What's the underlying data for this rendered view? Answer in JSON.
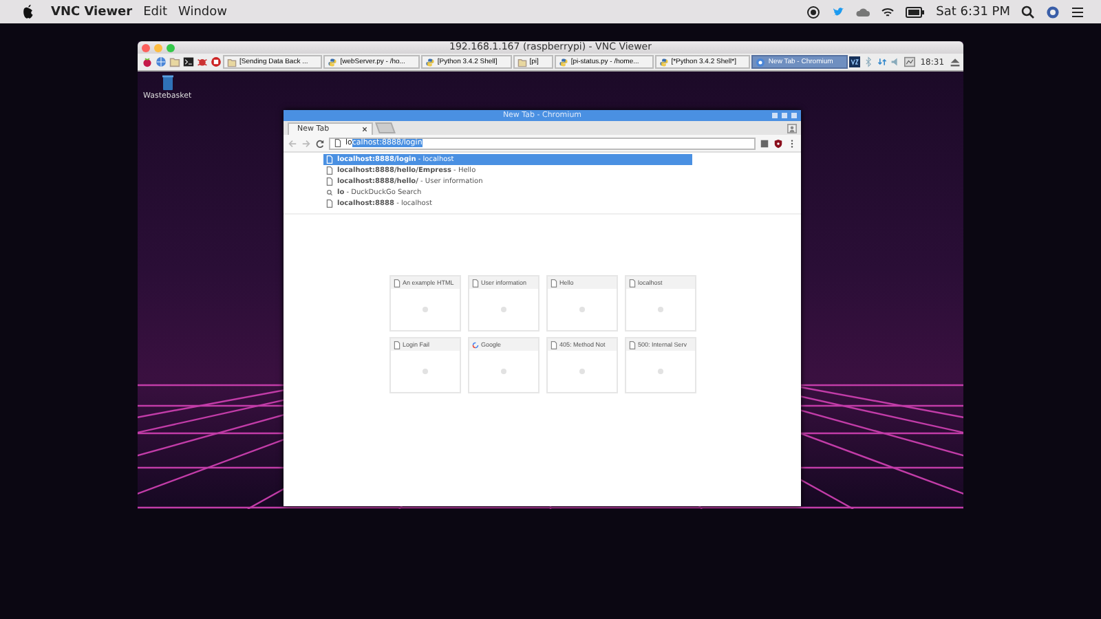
{
  "menubar": {
    "app": "VNC Viewer",
    "menus": [
      "Edit",
      "Window"
    ],
    "clock": "Sat 6:31 PM"
  },
  "vnc": {
    "title": "192.168.1.167 (raspberrypi) - VNC Viewer",
    "tasks": [
      {
        "label": "[Sending Data Back ...",
        "kind": "folder",
        "selected": false
      },
      {
        "label": "[webServer.py - /ho...",
        "kind": "python",
        "selected": false
      },
      {
        "label": "[Python 3.4.2 Shell]",
        "kind": "python",
        "selected": false
      },
      {
        "label": "[pi]",
        "kind": "folder",
        "selected": false
      },
      {
        "label": "[pi-status.py - /home...",
        "kind": "python",
        "selected": false
      },
      {
        "label": "[*Python 3.4.2 Shell*]",
        "kind": "python",
        "selected": false
      },
      {
        "label": "New Tab - Chromium",
        "kind": "browser",
        "selected": true
      }
    ],
    "tray_clock": "18:31",
    "desktop_icon": "Wastebasket"
  },
  "browser": {
    "title": "New Tab - Chromium",
    "tabs": [
      {
        "label": "New Tab",
        "selected": true
      }
    ],
    "omnibox": {
      "typed": "lo",
      "completion": "calhost:8888/login"
    },
    "suggestions": [
      {
        "kind": "page",
        "text": "**localhost:8888/login** - localhost",
        "selected": true
      },
      {
        "kind": "page",
        "text": "**localhost:8888/hello/Empress** - Hello",
        "selected": false
      },
      {
        "kind": "page",
        "text": "**localhost:8888/hello/** - User information",
        "selected": false
      },
      {
        "kind": "search",
        "text": "**lo** - DuckDuckGo Search",
        "selected": false
      },
      {
        "kind": "page",
        "text": "**localhost:8888** - localhost",
        "selected": false
      }
    ],
    "tiles": [
      {
        "kind": "page",
        "title": "An example HTML"
      },
      {
        "kind": "page",
        "title": "User information"
      },
      {
        "kind": "page",
        "title": "Hello"
      },
      {
        "kind": "page",
        "title": "localhost"
      },
      {
        "kind": "page",
        "title": "Login Fail"
      },
      {
        "kind": "google",
        "title": "Google"
      },
      {
        "kind": "page",
        "title": "405: Method Not"
      },
      {
        "kind": "page",
        "title": "500: Internal Serv"
      }
    ]
  }
}
